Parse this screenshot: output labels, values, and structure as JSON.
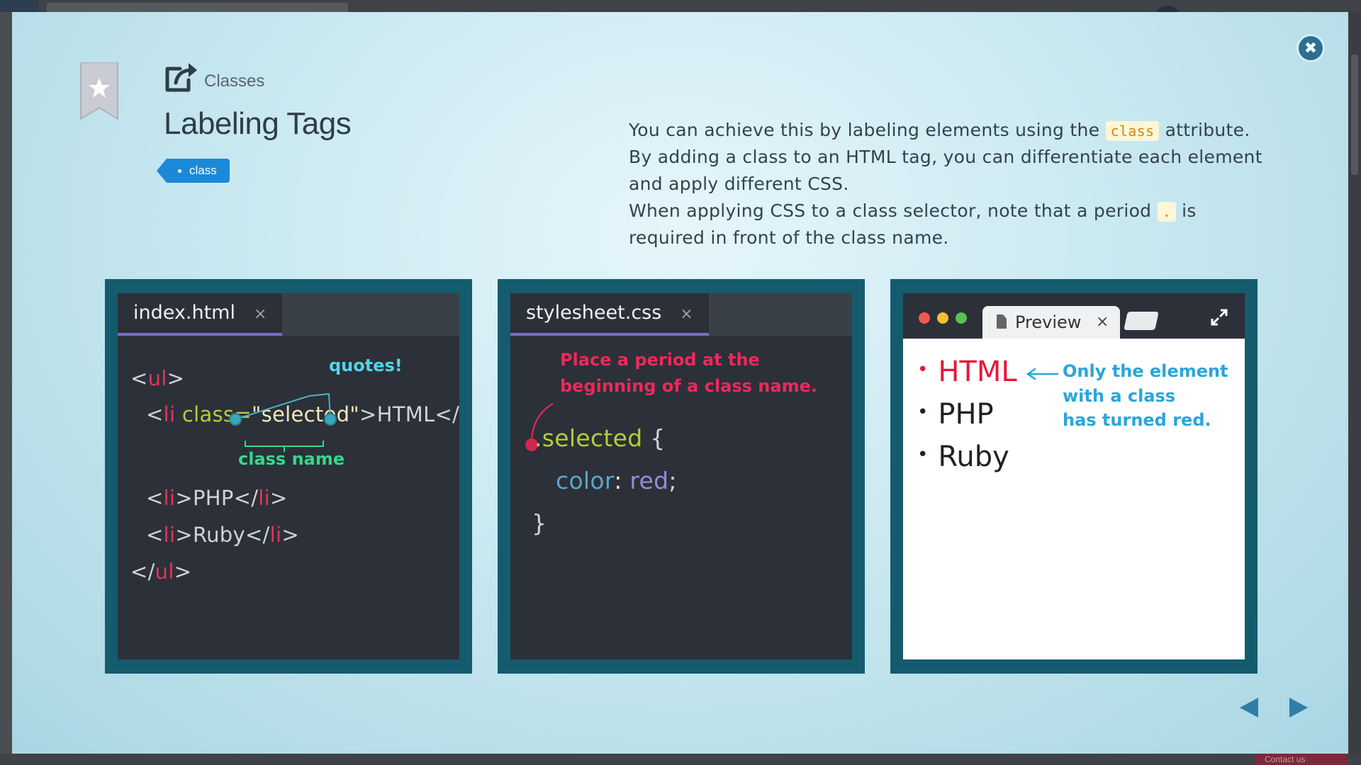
{
  "header": {
    "course_label": "Classes",
    "title": "Labeling Tags",
    "tag": "class"
  },
  "description": {
    "line1_before": "You can achieve this by labeling elements using the ",
    "line1_code": "class",
    "line1_after": " attribute.",
    "line2": "By adding a class to an HTML tag, you can differentiate each element and apply different CSS.",
    "line3_before": "When applying CSS to a class selector, note that a period ",
    "line3_code": ".",
    "line3_after": " is required in front of the class name."
  },
  "html_panel": {
    "tab_label": "index.html",
    "tab_close": "×",
    "code": {
      "open_lt": "<",
      "open_tag": "ul",
      "open_gt": ">",
      "li_lt": "<",
      "li_tag": "li",
      "attr": " class=",
      "q1": "\"",
      "value": "selected",
      "q2": "\"",
      "li_text": ">HTML</",
      "li_close": "li",
      "li_end": ">",
      "php": "PHP",
      "ruby": "Ruby",
      "close_ul": "ul"
    },
    "note_quotes": "quotes!",
    "note_class_name": "class name"
  },
  "css_panel": {
    "tab_label": "stylesheet.css",
    "tab_close": "×",
    "note_line1": "Place a period at the",
    "note_line2": "beginning of a class name.",
    "selector": "selected",
    "brace_open": " {",
    "prop": "color",
    "colon": ":",
    "val": "red",
    "semi": ";",
    "brace_close": "}"
  },
  "preview_panel": {
    "tab_label": "Preview",
    "tab_close": "×",
    "items": [
      "HTML",
      "PHP",
      "Ruby"
    ],
    "bullet": "•",
    "note_line1": "Only the element",
    "note_line2": "with a class",
    "note_line3": "has turned red."
  },
  "colors": {
    "highlight_red": "#e8163a",
    "note_blue": "#2aa5db",
    "note_pink": "#f0285a",
    "note_cyan": "#4fd6e8",
    "note_green": "#33d98a"
  },
  "footer": {
    "contact_label": "Contact us"
  }
}
